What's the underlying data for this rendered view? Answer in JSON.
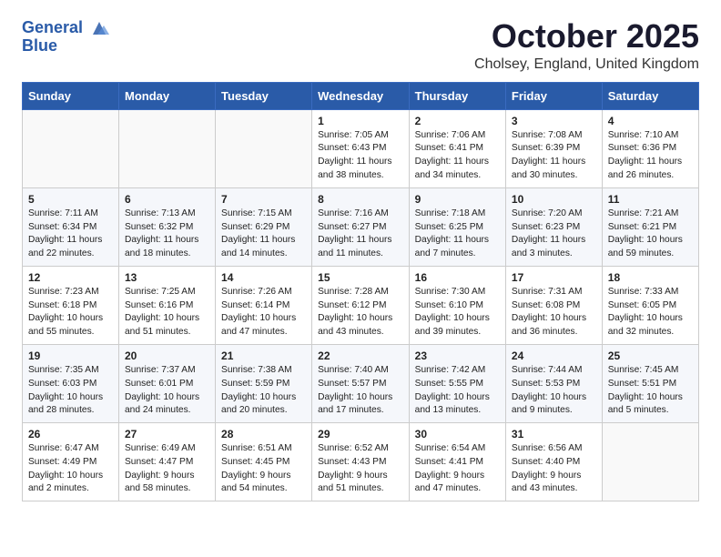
{
  "logo": {
    "line1": "General",
    "line2": "Blue"
  },
  "title": "October 2025",
  "location": "Cholsey, England, United Kingdom",
  "days_of_week": [
    "Sunday",
    "Monday",
    "Tuesday",
    "Wednesday",
    "Thursday",
    "Friday",
    "Saturday"
  ],
  "weeks": [
    [
      {
        "day": "",
        "info": ""
      },
      {
        "day": "",
        "info": ""
      },
      {
        "day": "",
        "info": ""
      },
      {
        "day": "1",
        "info": "Sunrise: 7:05 AM\nSunset: 6:43 PM\nDaylight: 11 hours\nand 38 minutes."
      },
      {
        "day": "2",
        "info": "Sunrise: 7:06 AM\nSunset: 6:41 PM\nDaylight: 11 hours\nand 34 minutes."
      },
      {
        "day": "3",
        "info": "Sunrise: 7:08 AM\nSunset: 6:39 PM\nDaylight: 11 hours\nand 30 minutes."
      },
      {
        "day": "4",
        "info": "Sunrise: 7:10 AM\nSunset: 6:36 PM\nDaylight: 11 hours\nand 26 minutes."
      }
    ],
    [
      {
        "day": "5",
        "info": "Sunrise: 7:11 AM\nSunset: 6:34 PM\nDaylight: 11 hours\nand 22 minutes."
      },
      {
        "day": "6",
        "info": "Sunrise: 7:13 AM\nSunset: 6:32 PM\nDaylight: 11 hours\nand 18 minutes."
      },
      {
        "day": "7",
        "info": "Sunrise: 7:15 AM\nSunset: 6:29 PM\nDaylight: 11 hours\nand 14 minutes."
      },
      {
        "day": "8",
        "info": "Sunrise: 7:16 AM\nSunset: 6:27 PM\nDaylight: 11 hours\nand 11 minutes."
      },
      {
        "day": "9",
        "info": "Sunrise: 7:18 AM\nSunset: 6:25 PM\nDaylight: 11 hours\nand 7 minutes."
      },
      {
        "day": "10",
        "info": "Sunrise: 7:20 AM\nSunset: 6:23 PM\nDaylight: 11 hours\nand 3 minutes."
      },
      {
        "day": "11",
        "info": "Sunrise: 7:21 AM\nSunset: 6:21 PM\nDaylight: 10 hours\nand 59 minutes."
      }
    ],
    [
      {
        "day": "12",
        "info": "Sunrise: 7:23 AM\nSunset: 6:18 PM\nDaylight: 10 hours\nand 55 minutes."
      },
      {
        "day": "13",
        "info": "Sunrise: 7:25 AM\nSunset: 6:16 PM\nDaylight: 10 hours\nand 51 minutes."
      },
      {
        "day": "14",
        "info": "Sunrise: 7:26 AM\nSunset: 6:14 PM\nDaylight: 10 hours\nand 47 minutes."
      },
      {
        "day": "15",
        "info": "Sunrise: 7:28 AM\nSunset: 6:12 PM\nDaylight: 10 hours\nand 43 minutes."
      },
      {
        "day": "16",
        "info": "Sunrise: 7:30 AM\nSunset: 6:10 PM\nDaylight: 10 hours\nand 39 minutes."
      },
      {
        "day": "17",
        "info": "Sunrise: 7:31 AM\nSunset: 6:08 PM\nDaylight: 10 hours\nand 36 minutes."
      },
      {
        "day": "18",
        "info": "Sunrise: 7:33 AM\nSunset: 6:05 PM\nDaylight: 10 hours\nand 32 minutes."
      }
    ],
    [
      {
        "day": "19",
        "info": "Sunrise: 7:35 AM\nSunset: 6:03 PM\nDaylight: 10 hours\nand 28 minutes."
      },
      {
        "day": "20",
        "info": "Sunrise: 7:37 AM\nSunset: 6:01 PM\nDaylight: 10 hours\nand 24 minutes."
      },
      {
        "day": "21",
        "info": "Sunrise: 7:38 AM\nSunset: 5:59 PM\nDaylight: 10 hours\nand 20 minutes."
      },
      {
        "day": "22",
        "info": "Sunrise: 7:40 AM\nSunset: 5:57 PM\nDaylight: 10 hours\nand 17 minutes."
      },
      {
        "day": "23",
        "info": "Sunrise: 7:42 AM\nSunset: 5:55 PM\nDaylight: 10 hours\nand 13 minutes."
      },
      {
        "day": "24",
        "info": "Sunrise: 7:44 AM\nSunset: 5:53 PM\nDaylight: 10 hours\nand 9 minutes."
      },
      {
        "day": "25",
        "info": "Sunrise: 7:45 AM\nSunset: 5:51 PM\nDaylight: 10 hours\nand 5 minutes."
      }
    ],
    [
      {
        "day": "26",
        "info": "Sunrise: 6:47 AM\nSunset: 4:49 PM\nDaylight: 10 hours\nand 2 minutes."
      },
      {
        "day": "27",
        "info": "Sunrise: 6:49 AM\nSunset: 4:47 PM\nDaylight: 9 hours\nand 58 minutes."
      },
      {
        "day": "28",
        "info": "Sunrise: 6:51 AM\nSunset: 4:45 PM\nDaylight: 9 hours\nand 54 minutes."
      },
      {
        "day": "29",
        "info": "Sunrise: 6:52 AM\nSunset: 4:43 PM\nDaylight: 9 hours\nand 51 minutes."
      },
      {
        "day": "30",
        "info": "Sunrise: 6:54 AM\nSunset: 4:41 PM\nDaylight: 9 hours\nand 47 minutes."
      },
      {
        "day": "31",
        "info": "Sunrise: 6:56 AM\nSunset: 4:40 PM\nDaylight: 9 hours\nand 43 minutes."
      },
      {
        "day": "",
        "info": ""
      }
    ]
  ]
}
